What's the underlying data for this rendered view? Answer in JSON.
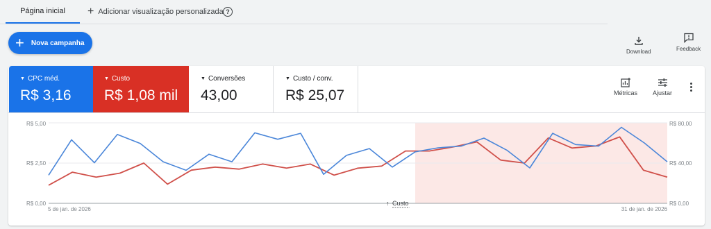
{
  "tabs": {
    "home": "Página inicial",
    "add": "Adicionar visualização personalizada"
  },
  "toolbar": {
    "new_campaign": "Nova campanha",
    "download": "Download",
    "feedback": "Feedback"
  },
  "metrics": [
    {
      "label": "CPC méd.",
      "value": "R$ 3,16",
      "color": "#1a73e8"
    },
    {
      "label": "Custo",
      "value": "R$ 1,08 mil",
      "color": "#d93025"
    },
    {
      "label": "Conversões",
      "value": "43,00"
    },
    {
      "label": "Custo / conv.",
      "value": "R$ 25,07"
    }
  ],
  "controls": {
    "metrics": "Métricas",
    "adjust": "Ajustar"
  },
  "chart_data": {
    "type": "line",
    "y_left": {
      "ticks": [
        "R$ 5,00",
        "R$ 2,50",
        "R$ 0,00"
      ],
      "range": [
        0,
        5
      ]
    },
    "y_right": {
      "ticks": [
        "R$ 80,00",
        "R$ 40,00",
        "R$ 0,00"
      ],
      "range": [
        0,
        80
      ]
    },
    "x_labels": {
      "start": "5 de jan. de 2026",
      "end": "31 de jan. de 2026"
    },
    "annotation": "Custo",
    "highlight_range": [
      16,
      26
    ],
    "highlight_color": "#fce8e6",
    "series": [
      {
        "name": "CPC méd.",
        "axis": "left",
        "color": "#4a86d9",
        "values": [
          1.75,
          3.95,
          2.52,
          4.28,
          3.72,
          2.58,
          2.05,
          3.05,
          2.58,
          4.38,
          3.98,
          4.35,
          1.8,
          2.98,
          3.4,
          2.25,
          3.2,
          3.45,
          3.55,
          4.05,
          3.3,
          2.2,
          4.35,
          3.65,
          3.55,
          4.72,
          3.75,
          2.58
        ]
      },
      {
        "name": "Custo",
        "axis": "right",
        "color": "#d0504a",
        "values": [
          18,
          31,
          26,
          30,
          40,
          19,
          33,
          36,
          34,
          39,
          35,
          39,
          28,
          35,
          37,
          52,
          52,
          56,
          61,
          43,
          40,
          65,
          55,
          57,
          66,
          33,
          26
        ]
      }
    ]
  }
}
